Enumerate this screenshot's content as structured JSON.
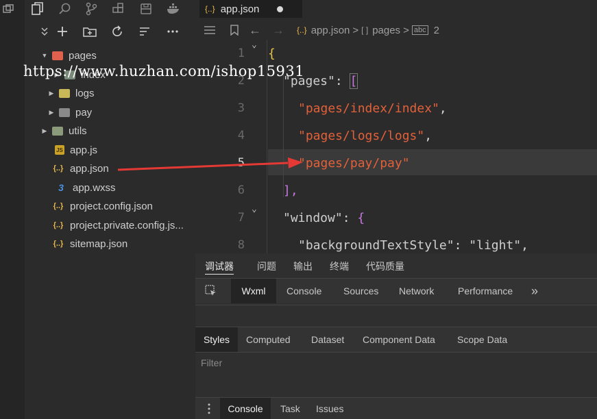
{
  "explorer": {
    "tree": [
      {
        "label": "pages",
        "kind": "folder-open",
        "icon": "folder-pages-icon"
      },
      {
        "label": "index",
        "kind": "folder",
        "icon": "folder-icon"
      },
      {
        "label": "logs",
        "kind": "folder",
        "icon": "folder-icon"
      },
      {
        "label": "pay",
        "kind": "folder",
        "icon": "folder-icon"
      },
      {
        "label": "utils",
        "kind": "folder",
        "icon": "folder-icon"
      },
      {
        "label": "app.js",
        "kind": "file",
        "icon": "js-file-icon",
        "badge": "JS"
      },
      {
        "label": "app.json",
        "kind": "file",
        "icon": "json-file-icon",
        "badge": "{..}"
      },
      {
        "label": "app.wxss",
        "kind": "file",
        "icon": "css-file-icon",
        "badge": "3"
      },
      {
        "label": "project.config.json",
        "kind": "file",
        "icon": "json-file-icon",
        "badge": "{..}"
      },
      {
        "label": "project.private.config.js...",
        "kind": "file",
        "icon": "json-file-icon",
        "badge": "{..}"
      },
      {
        "label": "sitemap.json",
        "kind": "file",
        "icon": "json-file-icon",
        "badge": "{..}"
      }
    ]
  },
  "watermark": "https://www.huzhan.com/ishop15931",
  "editor": {
    "tab_label": "app.json",
    "tab_icon": "{..}",
    "breadcrumb": {
      "file": "app.json",
      "sep1": ">",
      "key": "pages",
      "sep2": ">",
      "index": "2"
    },
    "line_numbers": [
      "1",
      "2",
      "3",
      "4",
      "5",
      "6",
      "7",
      "8"
    ],
    "active_line": "5",
    "lines": {
      "l1": "{",
      "l2_key": "\"pages\"",
      "l2_colon": ": ",
      "l2_bracket": "[",
      "l3": "\"pages/index/index\"",
      "l4": "\"pages/logs/logs\"",
      "l5": "\"pages/pay/pay\"",
      "l6": "],",
      "l7_key": "\"window\"",
      "l7_colon": ": ",
      "l7_brace": "{",
      "l8_key": "\"backgroundTextStyle\"",
      "l8_colon": ": ",
      "l8_value": "\"light\"",
      "comma": ","
    }
  },
  "devtools": {
    "top_tabs": [
      "调试器",
      "问题",
      "输出",
      "终端",
      "代码质量"
    ],
    "panel_tabs": [
      "Wxml",
      "Console",
      "Sources",
      "Network",
      "Performance"
    ],
    "more": "»",
    "sub_tabs": [
      "Styles",
      "Computed",
      "Dataset",
      "Component Data",
      "Scope Data"
    ],
    "filter_placeholder": "Filter",
    "drawer_tabs": [
      "Console",
      "Task",
      "Issues"
    ]
  },
  "colors": {
    "annotation_arrow": "#e53935",
    "string": "#e2613a",
    "brace": "#e8c44a"
  }
}
